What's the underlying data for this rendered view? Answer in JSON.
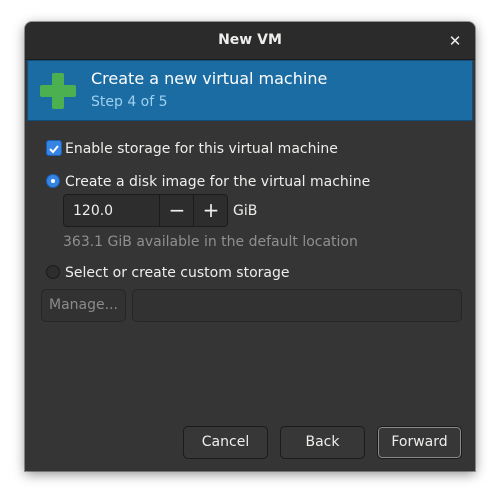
{
  "window": {
    "title": "New VM"
  },
  "banner": {
    "title": "Create a new virtual machine",
    "subtitle": "Step 4 of 5"
  },
  "storage": {
    "enable_label": "Enable storage for this virtual machine",
    "enable_checked": true,
    "create_disk_label": "Create a disk image for the virtual machine",
    "disk_size": "120.0",
    "disk_unit": "GiB",
    "available_text": "363.1 GiB available in the default location",
    "custom_label": "Select or create custom storage",
    "manage_label": "Manage...",
    "custom_path": ""
  },
  "buttons": {
    "cancel": "Cancel",
    "back": "Back",
    "forward": "Forward"
  },
  "colors": {
    "accent": "#3584e4",
    "banner": "#1c6ca4",
    "plus": "#4caf50"
  }
}
